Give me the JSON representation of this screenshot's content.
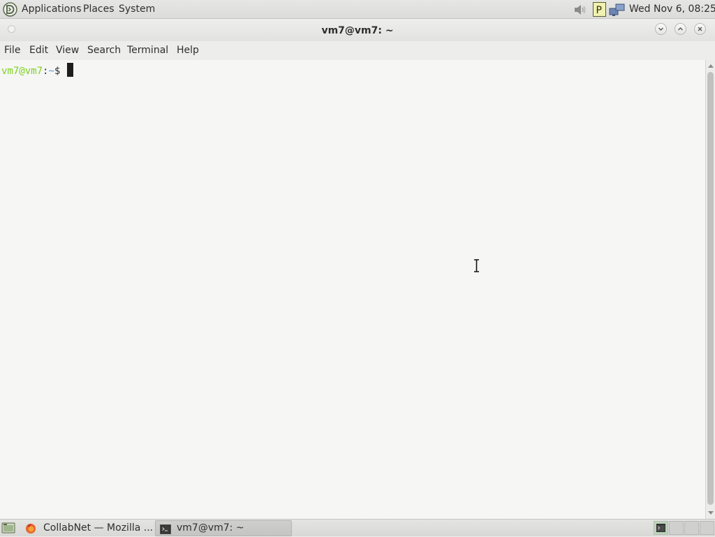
{
  "top_panel": {
    "menus": [
      "Applications",
      "Places",
      "System"
    ],
    "clock": "Wed Nov  6, 08:25",
    "tray_icons": [
      "volume-icon",
      "p-icon",
      "network-icon"
    ]
  },
  "window": {
    "title": "vm7@vm7: ~"
  },
  "menubar": {
    "items": [
      "File",
      "Edit",
      "View",
      "Search",
      "Terminal",
      "Help"
    ]
  },
  "terminal": {
    "prompt_user": "vm7@vm7",
    "prompt_sep": ":",
    "prompt_path": "~",
    "prompt_symbol": "$ ",
    "colors": {
      "background": "#f6f6f5",
      "user_host": "#7ed321",
      "path": "#5b9bd5",
      "cursor": "#1e1e1e"
    }
  },
  "bottom_panel": {
    "tasks": [
      {
        "label": "CollabNet — Mozilla ...",
        "icon": "firefox-icon",
        "active": false
      },
      {
        "label": "vm7@vm7: ~",
        "icon": "terminal-icon",
        "active": true
      }
    ]
  }
}
